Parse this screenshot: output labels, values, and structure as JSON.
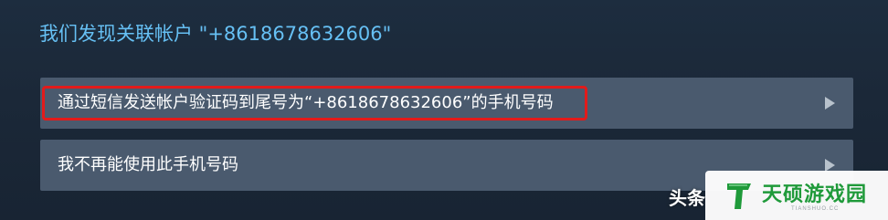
{
  "heading": "我们发现关联帐户 \"+8618678632606\"",
  "options": [
    {
      "label": "通过短信发送帐户验证码到尾号为“+8618678632606”的手机号码",
      "icon": "chevron-right-icon",
      "highlighted": true
    },
    {
      "label": "我不再能使用此手机号码",
      "icon": "chevron-right-icon",
      "highlighted": false
    }
  ],
  "colors": {
    "background": "#1b2838",
    "heading": "#66c0f4",
    "option_bg": "#4a5a6e",
    "highlight": "#e21b1b",
    "brand": "#1f9a3a"
  },
  "watermark": {
    "left_text": "头条",
    "brand": "天硕游戏园",
    "domain": "TIANSHUO.CC",
    "logo_icon": "t-logo-icon"
  }
}
